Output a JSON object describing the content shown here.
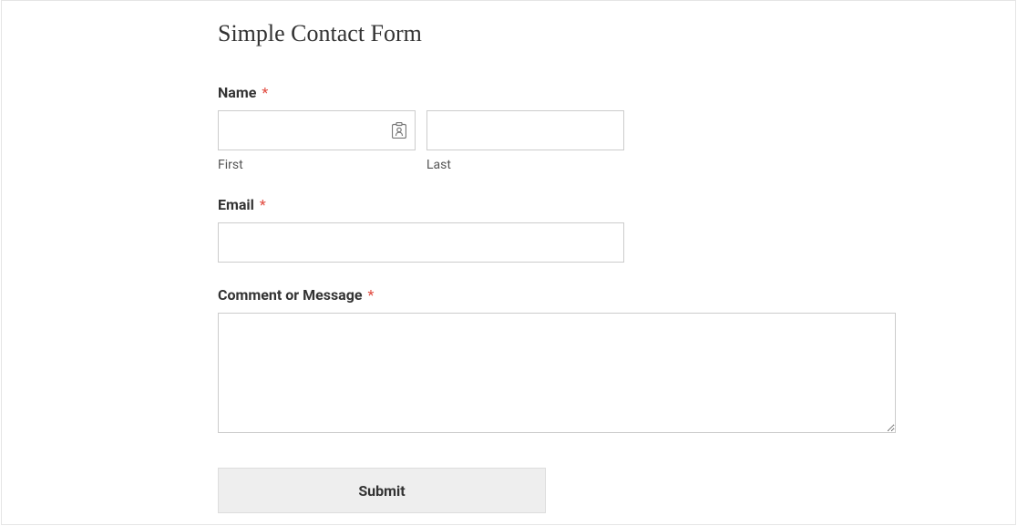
{
  "form": {
    "title": "Simple Contact Form",
    "name": {
      "label": "Name",
      "first_sublabel": "First",
      "last_sublabel": "Last",
      "first_value": "",
      "last_value": ""
    },
    "email": {
      "label": "Email",
      "value": ""
    },
    "message": {
      "label": "Comment or Message",
      "value": ""
    },
    "required_marker": "*",
    "submit_label": "Submit"
  }
}
